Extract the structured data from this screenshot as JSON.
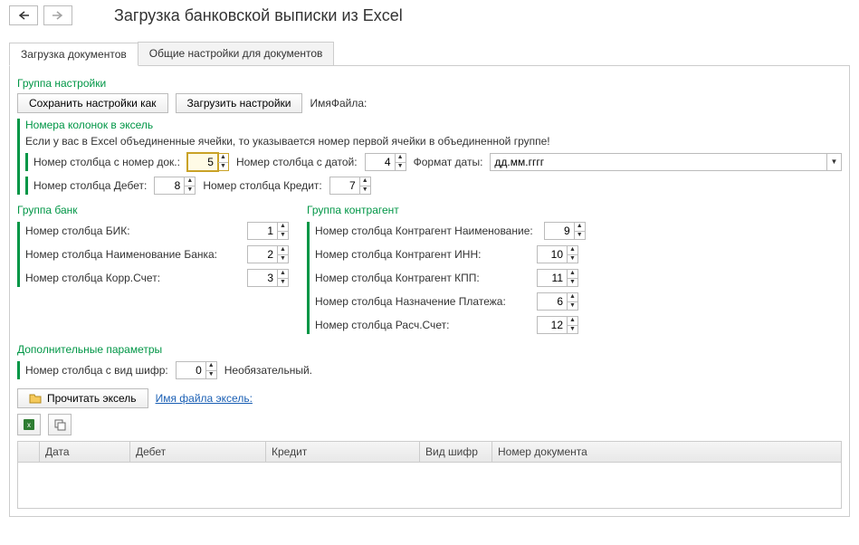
{
  "header": {
    "title": "Загрузка банковской выписки из Excel"
  },
  "tabs": [
    {
      "label": "Загрузка документов",
      "active": true
    },
    {
      "label": "Общие настройки для документов",
      "active": false
    }
  ],
  "settingsGroup": {
    "title": "Группа настройки",
    "saveAs": "Сохранить настройки как",
    "load": "Загрузить настройки",
    "fileNameLabel": "ИмяФайла:"
  },
  "columnsGroup": {
    "title": "Номера колонок в эксель",
    "hint": "Если у вас в Excel объединенные ячейки, то указывается номер первой ячейки в объединенной группе!",
    "docNumLabel": "Номер столбца с номер док.:",
    "docNum": "5",
    "dateLabel": "Номер столбца с датой:",
    "date": "4",
    "dateFormatLabel": "Формат даты:",
    "dateFormat": "дд.мм.гггг",
    "debitLabel": "Номер столбца Дебет:",
    "debit": "8",
    "creditLabel": "Номер столбца Кредит:",
    "credit": "7"
  },
  "bankGroup": {
    "title": "Группа банк",
    "bikLabel": "Номер столбца БИК:",
    "bik": "1",
    "bankNameLabel": "Номер столбца Наименование Банка:",
    "bankName": "2",
    "korrLabel": "Номер столбца Корр.Счет:",
    "korr": "3"
  },
  "contragentGroup": {
    "title": "Группа контрагент",
    "nameLabel": "Номер столбца Контрагент Наименование:",
    "name": "9",
    "innLabel": "Номер столбца Контрагент ИНН:",
    "inn": "10",
    "kppLabel": "Номер столбца Контрагент КПП:",
    "kpp": "11",
    "purposeLabel": "Номер столбца Назначение Платежа:",
    "purpose": "6",
    "accountLabel": "Номер столбца Расч.Счет:",
    "account": "12"
  },
  "extra": {
    "title": "Дополнительные параметры",
    "cipherLabel": "Номер столбца с вид шифр:",
    "cipher": "0",
    "optional": "Необязательный."
  },
  "read": {
    "btn": "Прочитать эксель",
    "fileLabel": "Имя файла эксель:"
  },
  "table": {
    "columns": [
      "Дата",
      "Дебет",
      "Кредит",
      "Вид шифр",
      "Номер документа"
    ]
  }
}
